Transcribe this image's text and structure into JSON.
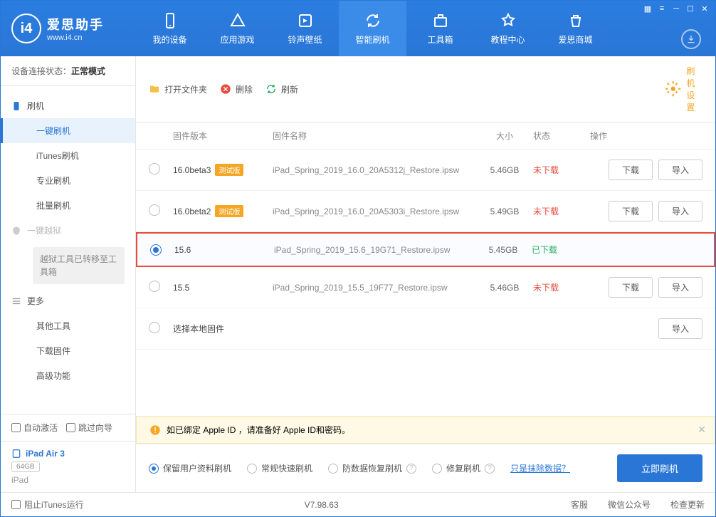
{
  "app": {
    "name": "爱思助手",
    "subtitle": "www.i4.cn"
  },
  "nav": [
    {
      "label": "我的设备"
    },
    {
      "label": "应用游戏"
    },
    {
      "label": "铃声壁纸"
    },
    {
      "label": "智能刷机",
      "active": true
    },
    {
      "label": "工具箱"
    },
    {
      "label": "教程中心"
    },
    {
      "label": "爱思商城"
    }
  ],
  "sidebar": {
    "status_label": "设备连接状态：",
    "status_value": "正常模式",
    "group_flash": "刷机",
    "items": [
      "一键刷机",
      "iTunes刷机",
      "专业刷机",
      "批量刷机"
    ],
    "group_jailbreak": "一键越狱",
    "jailbreak_note": "越狱工具已转移至工具箱",
    "group_more": "更多",
    "more_items": [
      "其他工具",
      "下载固件",
      "高级功能"
    ],
    "auto_activate": "自动激活",
    "skip_guide": "跳过向导",
    "device": {
      "name": "iPad Air 3",
      "capacity": "64GB",
      "type": "iPad"
    }
  },
  "toolbar": {
    "open": "打开文件夹",
    "delete": "删除",
    "refresh": "刷新",
    "settings": "刷机设置"
  },
  "columns": {
    "version": "固件版本",
    "name": "固件名称",
    "size": "大小",
    "status": "状态",
    "ops": "操作"
  },
  "firmware": [
    {
      "version": "16.0beta3",
      "beta": "测试版",
      "name": "iPad_Spring_2019_16.0_20A5312j_Restore.ipsw",
      "size": "5.46GB",
      "status": "未下载",
      "status_type": "not",
      "selected": false,
      "show_ops": true
    },
    {
      "version": "16.0beta2",
      "beta": "测试版",
      "name": "iPad_Spring_2019_16.0_20A5303i_Restore.ipsw",
      "size": "5.49GB",
      "status": "未下载",
      "status_type": "not",
      "selected": false,
      "show_ops": true
    },
    {
      "version": "15.6",
      "name": "iPad_Spring_2019_15.6_19G71_Restore.ipsw",
      "size": "5.45GB",
      "status": "已下载",
      "status_type": "done",
      "selected": true,
      "highlighted": true,
      "show_ops": false
    },
    {
      "version": "15.5",
      "name": "iPad_Spring_2019_15.5_19F77_Restore.ipsw",
      "size": "5.46GB",
      "status": "未下载",
      "status_type": "not",
      "selected": false,
      "show_ops": true
    },
    {
      "version": "选择本地固件",
      "name": "",
      "size": "",
      "status": "",
      "local": true
    }
  ],
  "buttons": {
    "download": "下载",
    "import": "导入"
  },
  "warning": "如已绑定 Apple ID ，请准备好 Apple ID和密码。",
  "flash_options": [
    {
      "label": "保留用户资料刷机",
      "selected": true
    },
    {
      "label": "常规快速刷机"
    },
    {
      "label": "防数据恢复刷机",
      "help": true
    },
    {
      "label": "修复刷机",
      "help": true
    }
  ],
  "flash_link": "只是抹除数据？",
  "flash_btn": "立即刷机",
  "footer": {
    "block_itunes": "阻止iTunes运行",
    "version": "V7.98.63",
    "links": [
      "客服",
      "微信公众号",
      "检查更新"
    ]
  }
}
